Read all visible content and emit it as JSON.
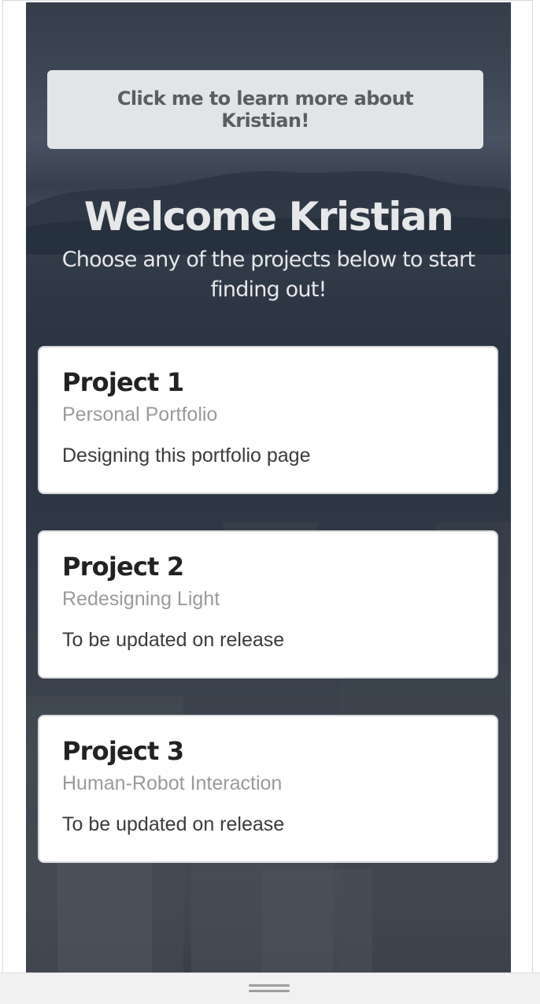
{
  "hero": {
    "learn_button_label": "Click me to learn more about Kristian!",
    "title": "Welcome Kristian",
    "subtitle": "Choose any of the projects below to start finding out!"
  },
  "projects": [
    {
      "title": "Project 1",
      "subtitle": "Personal Portfolio",
      "description": "Designing this portfolio page"
    },
    {
      "title": "Project 2",
      "subtitle": "Redesigning Light",
      "description": "To be updated on release"
    },
    {
      "title": "Project 3",
      "subtitle": "Human-Robot Interaction",
      "description": "To be updated on release"
    }
  ],
  "colors": {
    "button_bg": "#e3e4e6",
    "button_text": "#5a5d62",
    "hero_text": "#e6e7e9",
    "card_bg": "#ffffff",
    "card_title": "#222222",
    "card_subtitle": "#9a9a9a",
    "card_text": "#3b3b3b"
  },
  "icons": {
    "resize_handle": "drag-handle-icon"
  }
}
